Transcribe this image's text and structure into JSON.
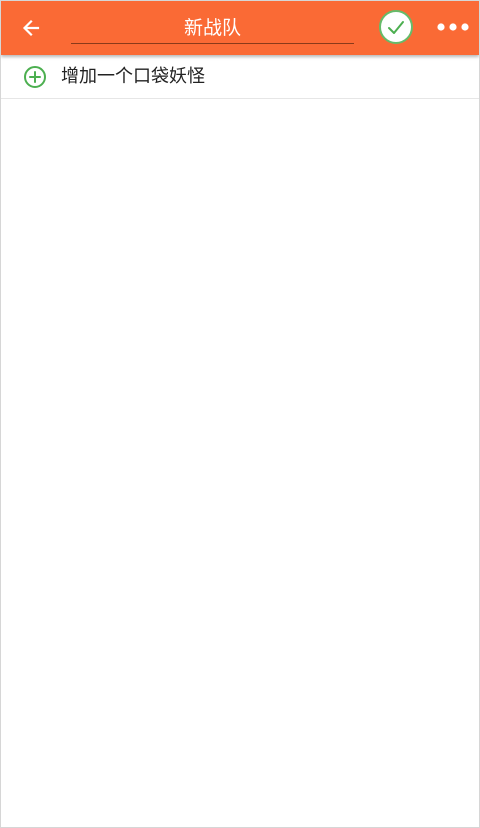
{
  "toolbar": {
    "background": "#fa6a35",
    "back_icon": "arrow-left-icon",
    "team_name": "新战队",
    "confirm_icon": "checkmark-circle-icon",
    "more_icon": "overflow-dots-icon"
  },
  "actions": {
    "add_pokemon_label": "增加一个口袋妖怪",
    "add_icon": "plus-circle-icon",
    "accent": "#4caf50"
  },
  "team_members": []
}
